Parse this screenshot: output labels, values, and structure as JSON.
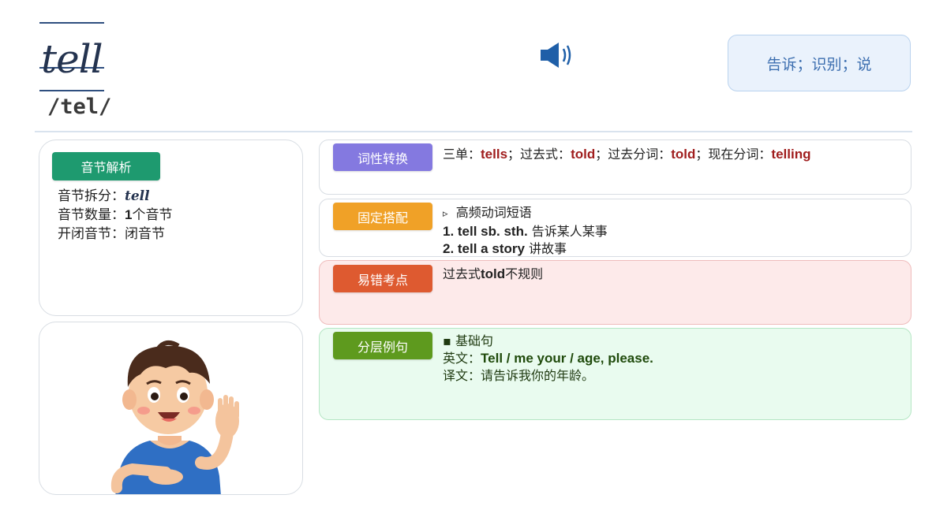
{
  "word": {
    "text": "tell",
    "phonetic": "/tel/",
    "meaning": "告诉；识别；说"
  },
  "syllable": {
    "tag": "音节解析",
    "split_label": "音节拆分：",
    "split_value": "tell",
    "count_label": "音节数量：",
    "count_num": "1",
    "count_unit": "个音节",
    "open_label": "开闭音节：",
    "open_value": "闭音节"
  },
  "pos": {
    "tag": "词性转换",
    "l1": "三单：",
    "v1": "tells",
    "l2": "；过去式：",
    "v2": "told",
    "l3": "；过去分词：",
    "v3": "told",
    "l4": "；现在分词：",
    "v4": "telling"
  },
  "collocation": {
    "tag": "固定搭配",
    "bullet": "▹",
    "heading": "高频动词短语",
    "item1_en": "1. tell sb. sth.",
    "item1_zh": " 告诉某人某事",
    "item2_en": "2. tell a story",
    "item2_zh": " 讲故事"
  },
  "error": {
    "tag": "易错考点",
    "pre": "过去式",
    "word": "told",
    "post": "不规则"
  },
  "example": {
    "tag": "分层例句",
    "bullet": "▪",
    "level": "基础句",
    "en_label": "英文：",
    "en_text": "Tell / me your / age, please.",
    "zh_label": "译文：",
    "zh_text": "请告诉我你的年龄。"
  },
  "icons": {
    "speaker": "speaker-icon",
    "boy": "boy-waving-illustration"
  },
  "colors": {
    "syllable_tag": "#1e9a6f",
    "pos_tag": "#8479e0",
    "collocation_tag": "#f0a127",
    "error_tag": "#de5a30",
    "example_tag": "#5e9a1e",
    "highlight_red": "#a01e1e"
  }
}
